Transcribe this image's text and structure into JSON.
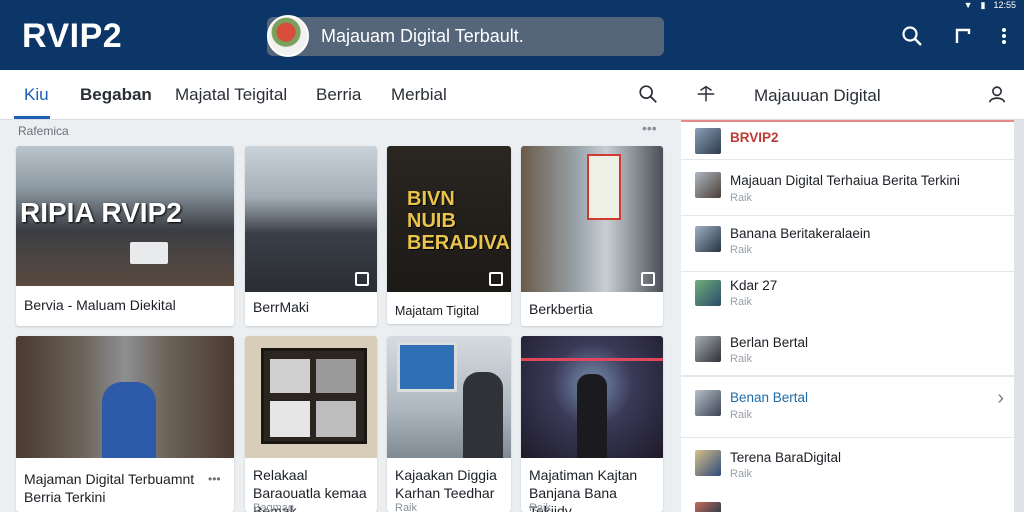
{
  "status": {
    "text": "12:55"
  },
  "app": {
    "title": "RVIP2"
  },
  "search": {
    "text": "Majauam Digital Terbault."
  },
  "tabs": [
    {
      "label": "Kiu",
      "active": true
    },
    {
      "label": "Begaban",
      "active": false
    },
    {
      "label": "Majatal Teigital",
      "active": false
    },
    {
      "label": "Berria",
      "active": false
    },
    {
      "label": "Merbial",
      "active": false
    }
  ],
  "side_header": {
    "title": "Majauuan Digital"
  },
  "section": {
    "label": "Rafemica"
  },
  "cards": [
    {
      "title": "Bervia - Maluam Diekital",
      "overlay": "RIPIA RVIP2"
    },
    {
      "title": "BerrMaki"
    },
    {
      "title": "Majatam Tigital",
      "overlay": "BIVN NUIB BERADIVAL"
    },
    {
      "title": "Berkbertia"
    },
    {
      "title": "Majaman Digital Terbuamnt Berria Terkini",
      "sub": ""
    },
    {
      "title": "Relakaal Baraouatla kemaa Bemak",
      "sub": "Bagmag"
    },
    {
      "title": "Kajaakan Diggia Karhan Teedhar",
      "sub": "Raik"
    },
    {
      "title": "Majatiman Kajtan Banjana Bana Tekiidy",
      "sub": "Raik"
    }
  ],
  "side_items": [
    {
      "title": "BRVIP2",
      "sub": ""
    },
    {
      "title": "Majauan Digital Terhaiua Berita Terkini",
      "sub": "Raik"
    },
    {
      "title": "Banana Beritakeralaein",
      "sub": "Raik"
    },
    {
      "title": "Kdar 27",
      "sub": "Raik"
    },
    {
      "title": "Berlan Bertal",
      "sub": "Raik"
    },
    {
      "title": "Benan Bertal",
      "sub": "Raik"
    },
    {
      "title": "Terena BaraDigital",
      "sub": "Raik"
    }
  ],
  "colors": {
    "topbar": "#0c3668",
    "accent": "#1a5fb4",
    "side_highlight": "#1f6ca8",
    "side_red": "#c03a33"
  }
}
